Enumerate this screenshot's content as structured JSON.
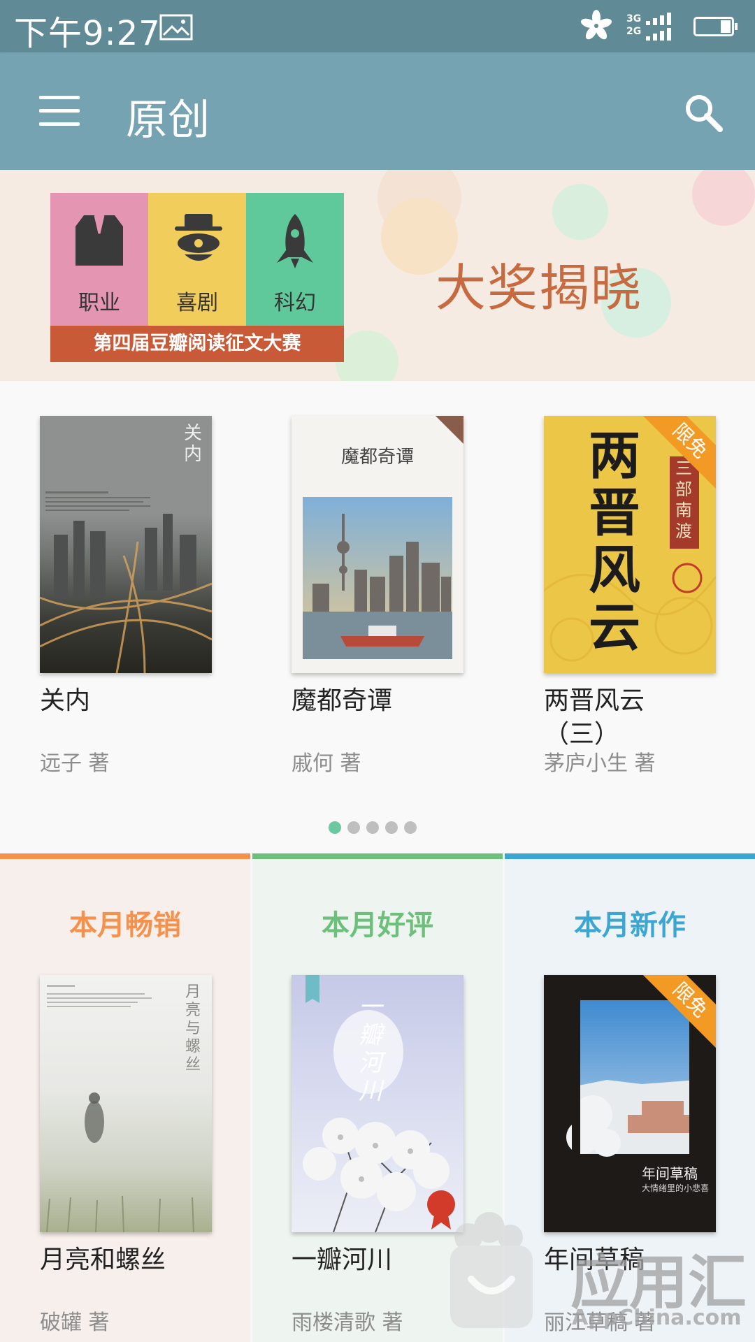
{
  "status_bar": {
    "time": "下午9:27",
    "network_top": "3G",
    "network_bottom": "2G",
    "icons": [
      "image-icon",
      "flower-icon",
      "signal-icon",
      "battery-icon"
    ]
  },
  "app_bar": {
    "title": "原创",
    "icons": [
      "menu-icon",
      "search-icon"
    ]
  },
  "banner": {
    "categories": [
      {
        "label": "职业",
        "color": "#e495b1",
        "icon": "vest-icon"
      },
      {
        "label": "喜剧",
        "color": "#f1cd5c",
        "icon": "clown-icon"
      },
      {
        "label": "科幻",
        "color": "#5fc99b",
        "icon": "rocket-icon"
      }
    ],
    "strip_text": "第四届豆瓣阅读征文大赛",
    "headline": "大奖揭晓"
  },
  "featured_books": [
    {
      "title": "关内",
      "author": "远子 著",
      "cover_title": "关内"
    },
    {
      "title": "魔都奇谭",
      "author": "戚何 著",
      "cover_title": "魔都奇谭"
    },
    {
      "title": "两晋风云（三）",
      "title_line1": "两晋风云",
      "title_line2": "（三）",
      "author": "茅庐小生 著",
      "cover_title": "两晋风云",
      "cover_side": "三部 南渡",
      "badge": "限免"
    }
  ],
  "pager": {
    "count": 5,
    "active": 0
  },
  "sections": [
    {
      "title": "本月畅销",
      "color": "#f5914a",
      "bg": "#f7efeb",
      "book": {
        "title": "月亮和螺丝",
        "author": "破罐 著",
        "cover_title": "月亮与螺丝"
      }
    },
    {
      "title": "本月好评",
      "color": "#6cc07b",
      "bg": "#eef4ef",
      "book": {
        "title": "一瓣河川",
        "author": "雨楼清歌 著",
        "cover_title": "一瓣河川"
      }
    },
    {
      "title": "本月新作",
      "color": "#3ba6d2",
      "bg": "#edf3f7",
      "book": {
        "title": "年间草稿",
        "author": "丽江草稿 著",
        "cover_title": "年间草稿",
        "cover_sub": "大情绪里的小悲喜",
        "badge": "限免"
      }
    }
  ],
  "watermark": {
    "brand": "应用汇",
    "domain": "AppChina.com"
  }
}
